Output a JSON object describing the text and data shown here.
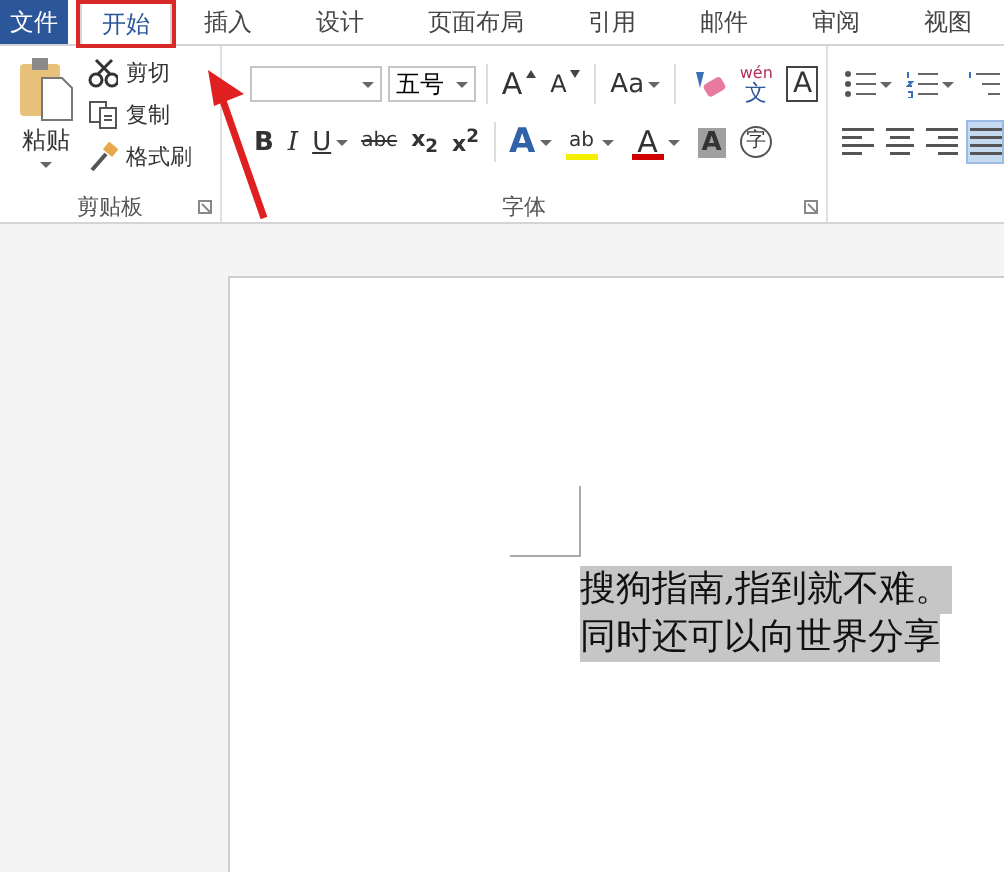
{
  "tabs": [
    {
      "label": "文件",
      "kind": "file",
      "selected": false
    },
    {
      "label": "开始",
      "kind": "tab",
      "selected": true
    },
    {
      "label": "插入",
      "kind": "tab",
      "selected": false
    },
    {
      "label": "设计",
      "kind": "tab",
      "selected": false
    },
    {
      "label": "页面布局",
      "kind": "tab",
      "selected": false
    },
    {
      "label": "引用",
      "kind": "tab",
      "selected": false
    },
    {
      "label": "邮件",
      "kind": "tab",
      "selected": false
    },
    {
      "label": "审阅",
      "kind": "tab",
      "selected": false
    },
    {
      "label": "视图",
      "kind": "tab",
      "selected": false
    }
  ],
  "clipboard": {
    "paste": "粘贴",
    "actions": [
      {
        "label": "剪切",
        "kind": "cut"
      },
      {
        "label": "复制",
        "kind": "copy"
      },
      {
        "label": "格式刷",
        "kind": "painter"
      }
    ],
    "group_label": "剪贴板"
  },
  "font": {
    "size": "五号",
    "row1": [
      {
        "kind": "grow",
        "label": "A"
      },
      {
        "kind": "shrink",
        "label": "A"
      },
      {
        "kind": "case",
        "label": "Aa",
        "dropdown": true
      },
      {
        "kind": "clear"
      },
      {
        "kind": "phonetic",
        "label": "wén",
        "sub_label": "文"
      },
      {
        "kind": "border",
        "label": "A"
      }
    ],
    "row2": [
      {
        "kind": "bold",
        "label": "B"
      },
      {
        "kind": "italic",
        "label": "I"
      },
      {
        "kind": "underline",
        "label": "U",
        "dropdown": true
      },
      {
        "kind": "strike",
        "label": "abc"
      },
      {
        "kind": "sub",
        "label": "x$_{2}$"
      },
      {
        "kind": "sup",
        "label": "x$^{2}$"
      },
      {
        "kind": "effect",
        "label": "A",
        "dropdown": true
      },
      {
        "kind": "highlight",
        "label": "ab",
        "dropdown": true
      },
      {
        "kind": "color",
        "label": "A",
        "dropdown": true
      },
      {
        "kind": "shade",
        "label": "A"
      },
      {
        "kind": "enclose",
        "label": "字"
      }
    ],
    "group_label": "字体"
  },
  "paragraph": {
    "row1": [
      {
        "kind": "bullets"
      },
      {
        "kind": "numbering"
      },
      {
        "kind": "multilevel"
      }
    ],
    "row2": [
      {
        "kind": "left",
        "selected": false
      },
      {
        "kind": "center",
        "selected": false
      },
      {
        "kind": "right",
        "selected": false
      },
      {
        "kind": "justify",
        "selected": true
      }
    ]
  },
  "document": {
    "lines": [
      "搜狗指南,指到就不难。",
      "同时还可以向世界分享"
    ]
  }
}
